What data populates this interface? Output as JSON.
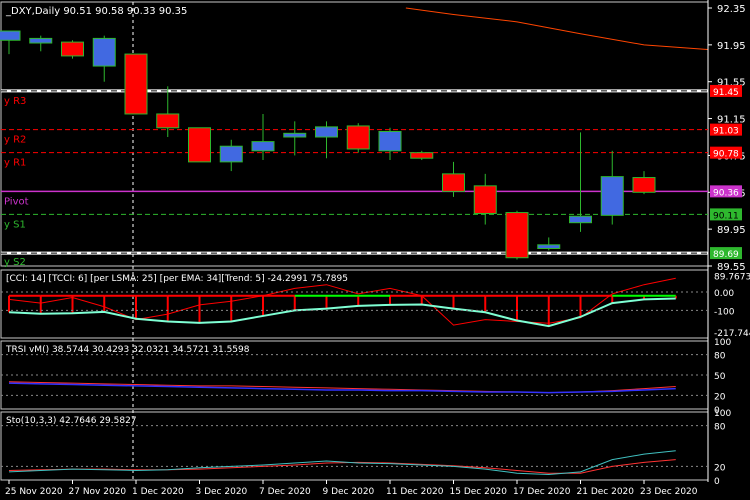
{
  "header": {
    "symbol_info": "_DXY,Daily  90.51 90.58 90.33 90.35"
  },
  "colors": {
    "background": "#000000",
    "bull_candle": "#4169E1",
    "bear_candle": "#FF0000",
    "candle_outline": "#2EB82E",
    "axis_text": "#FFFFFF",
    "pivot": "#CC33CC",
    "resistance": "#FF0000",
    "support": "#2EB82E",
    "cci_line": "#7FFFD4",
    "cci_hist": "#FF0000",
    "cci_trend_up": "#00FF00",
    "trsi_line1": "#3232FF",
    "trsi_line2": "#FF3333",
    "sto_main": "#40C0C0",
    "sto_signal": "#FF3333",
    "ma_line": "#FF4500"
  },
  "chart_data": {
    "type": "candlestick",
    "dates": [
      "25 Nov 2020",
      "27 Nov 2020",
      "1 Dec 2020",
      "3 Dec 2020",
      "7 Dec 2020",
      "9 Dec 2020",
      "11 Dec 2020",
      "15 Dec 2020",
      "17 Dec 2020",
      "21 Dec 2020",
      "23 Dec 2020"
    ],
    "price_axis": {
      "ylim": [
        89.55,
        92.35
      ],
      "ticks": [
        "92.35",
        "91.95",
        "91.55",
        "91.15",
        "90.75",
        "90.35",
        "89.95",
        "89.55"
      ]
    },
    "candles": [
      {
        "o": 92.0,
        "h": 92.1,
        "l": 91.85,
        "c": 92.1
      },
      {
        "o": 91.97,
        "h": 92.05,
        "l": 91.88,
        "c": 92.02
      },
      {
        "o": 91.98,
        "h": 92.0,
        "l": 91.8,
        "c": 91.83
      },
      {
        "o": 91.72,
        "h": 92.05,
        "l": 91.55,
        "c": 92.02
      },
      {
        "o": 91.85,
        "h": 91.85,
        "l": 91.2,
        "c": 91.2
      },
      {
        "o": 91.2,
        "h": 91.5,
        "l": 90.95,
        "c": 91.05
      },
      {
        "o": 91.05,
        "h": 91.05,
        "l": 90.7,
        "c": 90.68
      },
      {
        "o": 90.68,
        "h": 90.92,
        "l": 90.58,
        "c": 90.85
      },
      {
        "o": 90.8,
        "h": 91.2,
        "l": 90.7,
        "c": 90.9
      },
      {
        "o": 90.95,
        "h": 91.12,
        "l": 90.75,
        "c": 90.99
      },
      {
        "o": 90.95,
        "h": 91.12,
        "l": 90.72,
        "c": 91.06
      },
      {
        "o": 91.07,
        "h": 91.1,
        "l": 90.78,
        "c": 90.82
      },
      {
        "o": 90.8,
        "h": 91.05,
        "l": 90.7,
        "c": 91.01
      },
      {
        "o": 90.78,
        "h": 90.8,
        "l": 90.7,
        "c": 90.72
      },
      {
        "o": 90.55,
        "h": 90.68,
        "l": 90.3,
        "c": 90.36
      },
      {
        "o": 90.42,
        "h": 90.55,
        "l": 90.0,
        "c": 90.12
      },
      {
        "o": 90.13,
        "h": 90.15,
        "l": 89.62,
        "c": 89.64
      },
      {
        "o": 89.74,
        "h": 89.86,
        "l": 89.72,
        "c": 89.78
      },
      {
        "o": 90.02,
        "h": 91.0,
        "l": 89.92,
        "c": 90.09
      },
      {
        "o": 90.1,
        "h": 90.8,
        "l": 90.0,
        "c": 90.52
      },
      {
        "o": 90.51,
        "h": 90.58,
        "l": 90.33,
        "c": 90.35
      }
    ],
    "ma_line": [
      {
        "i": 12.5,
        "y": 92.35
      },
      {
        "i": 14,
        "y": 92.28
      },
      {
        "i": 16,
        "y": 92.2
      },
      {
        "i": 18,
        "y": 92.07
      },
      {
        "i": 20,
        "y": 91.95
      },
      {
        "i": 22,
        "y": 91.9
      }
    ],
    "levels": [
      {
        "name": "R3",
        "label": "y R3",
        "value": 91.45,
        "tag": "91.45",
        "style": "thickwhite"
      },
      {
        "name": "R2",
        "label": "y R2",
        "value": 91.03,
        "tag": "91.03",
        "style": "resistance"
      },
      {
        "name": "R1",
        "label": "y R1",
        "value": 90.78,
        "tag": "90.78",
        "style": "resistance"
      },
      {
        "name": "Pivot",
        "label": "Pivot",
        "value": 90.36,
        "tag": "90.36",
        "style": "pivot"
      },
      {
        "name": "S1",
        "label": "y S1",
        "value": 90.11,
        "tag": "90.11",
        "style": "support"
      },
      {
        "name": "S2",
        "label": "y S2",
        "value": 89.69,
        "tag": "89.69",
        "style": "thickwhite"
      }
    ],
    "cci": {
      "label": "[CCI: 14] [TCCI: 6] [per LSMA: 25] [per EMA: 34][Trend: 5]  -24.2991  75.7895",
      "ylim": [
        -250,
        120
      ],
      "ticks": [
        "89.7673",
        "0.00",
        "-100",
        "-217.744"
      ],
      "line": [
        -110,
        -118,
        -115,
        -108,
        -145,
        -160,
        -168,
        -160,
        -130,
        -100,
        -90,
        -75,
        -70,
        -68,
        -90,
        -110,
        -155,
        -185,
        -135,
        -60,
        -40,
        -35
      ],
      "hist_up": [
        false,
        false,
        false,
        false,
        false,
        false,
        false,
        false,
        false,
        true,
        true,
        true,
        true,
        false,
        false,
        false,
        false,
        false,
        false,
        true,
        true,
        true
      ],
      "trend_line": [
        -40,
        -60,
        -30,
        -80,
        -150,
        -120,
        -70,
        -50,
        -20,
        20,
        40,
        -10,
        20,
        -20,
        -180,
        -150,
        -160,
        -170,
        -140,
        -10,
        40,
        75
      ]
    },
    "trsi": {
      "label": "TRSI vM()  38.5744  30.4293  32.0321  34.5721  31.5598",
      "ylim": [
        0,
        100
      ],
      "ticks": [
        "100",
        "80",
        "50",
        "20",
        "0"
      ],
      "line1": [
        38,
        37,
        36,
        35,
        34,
        33,
        32,
        31,
        30,
        29,
        28,
        28,
        27,
        27,
        26,
        25,
        25,
        24,
        25,
        26,
        28,
        30
      ],
      "line2": [
        40,
        39,
        38,
        37,
        36,
        35,
        34,
        34,
        33,
        32,
        31,
        30,
        29,
        28,
        27,
        26,
        25,
        24,
        25,
        27,
        30,
        33
      ]
    },
    "sto": {
      "label": "Sto(10,3,3)  42.7646  29.5827",
      "ylim": [
        0,
        100
      ],
      "ticks": [
        "100",
        "80",
        "20",
        "0"
      ],
      "main": [
        12,
        14,
        16,
        15,
        14,
        15,
        18,
        20,
        22,
        25,
        28,
        25,
        24,
        22,
        20,
        16,
        10,
        8,
        12,
        30,
        38,
        43
      ],
      "signal": [
        14,
        15,
        16,
        16,
        15,
        15,
        16,
        18,
        20,
        22,
        25,
        26,
        25,
        23,
        21,
        18,
        14,
        10,
        10,
        20,
        26,
        30
      ]
    }
  }
}
